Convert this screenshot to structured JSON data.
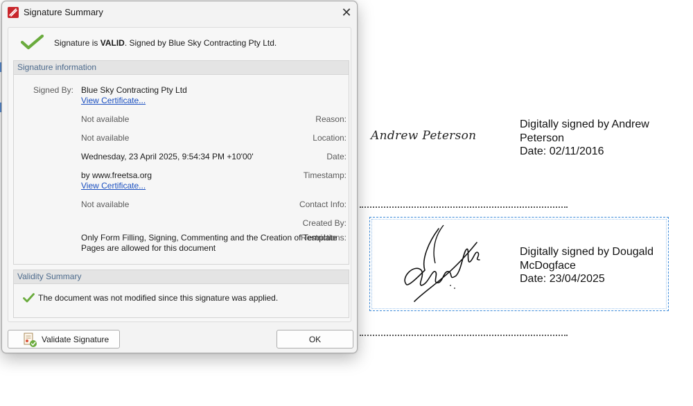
{
  "document": {
    "signature1": {
      "cursive_name": "Andrew Peterson",
      "line1": "Digitally signed by Andrew",
      "line2": "Peterson",
      "line3": "Date: 02/11/2016"
    },
    "signature2": {
      "line1": "Digitally signed by Dougald",
      "line2": "McDogface",
      "line3": "Date: 23/04/2025"
    }
  },
  "dialog": {
    "title": "Signature Summary",
    "close_glyph": "✕",
    "status": {
      "prefix": "Signature is ",
      "state": "VALID",
      "suffix": ". Signed by Blue Sky Contracting Pty Ltd."
    },
    "info_group": {
      "header": "Signature information",
      "signed_by_label": "Signed By:",
      "signed_by_value": "Blue Sky Contracting Pty Ltd",
      "view_certificate_1": "View Certificate...",
      "reason_label": "Reason:",
      "reason_value": "Not available",
      "location_label": "Location:",
      "location_value": "Not available",
      "date_label": "Date:",
      "date_value": "Wednesday, 23 April 2025, 9:54:34 PM +10'00'",
      "timestamp_label": "Timestamp:",
      "timestamp_value": "by www.freetsa.org",
      "view_certificate_2": "View Certificate...",
      "contact_label": "Contact Info:",
      "contact_value": "Not available",
      "created_label": "Created By:",
      "created_value": "",
      "restrictions_label": "Restrictions:",
      "restrictions_value": "Only Form Filling, Signing, Commenting and the Creation of Template Pages are allowed for this document"
    },
    "validity_group": {
      "header": "Validity Summary",
      "message": "The document was not modified since this signature was applied."
    },
    "buttons": {
      "validate": "Validate Signature",
      "ok": "OK"
    }
  },
  "colors": {
    "valid_green": "#6aab3d",
    "link_blue": "#1a4fc0",
    "group_header_text": "#4c6a8c",
    "app_icon_red": "#c8262b"
  }
}
